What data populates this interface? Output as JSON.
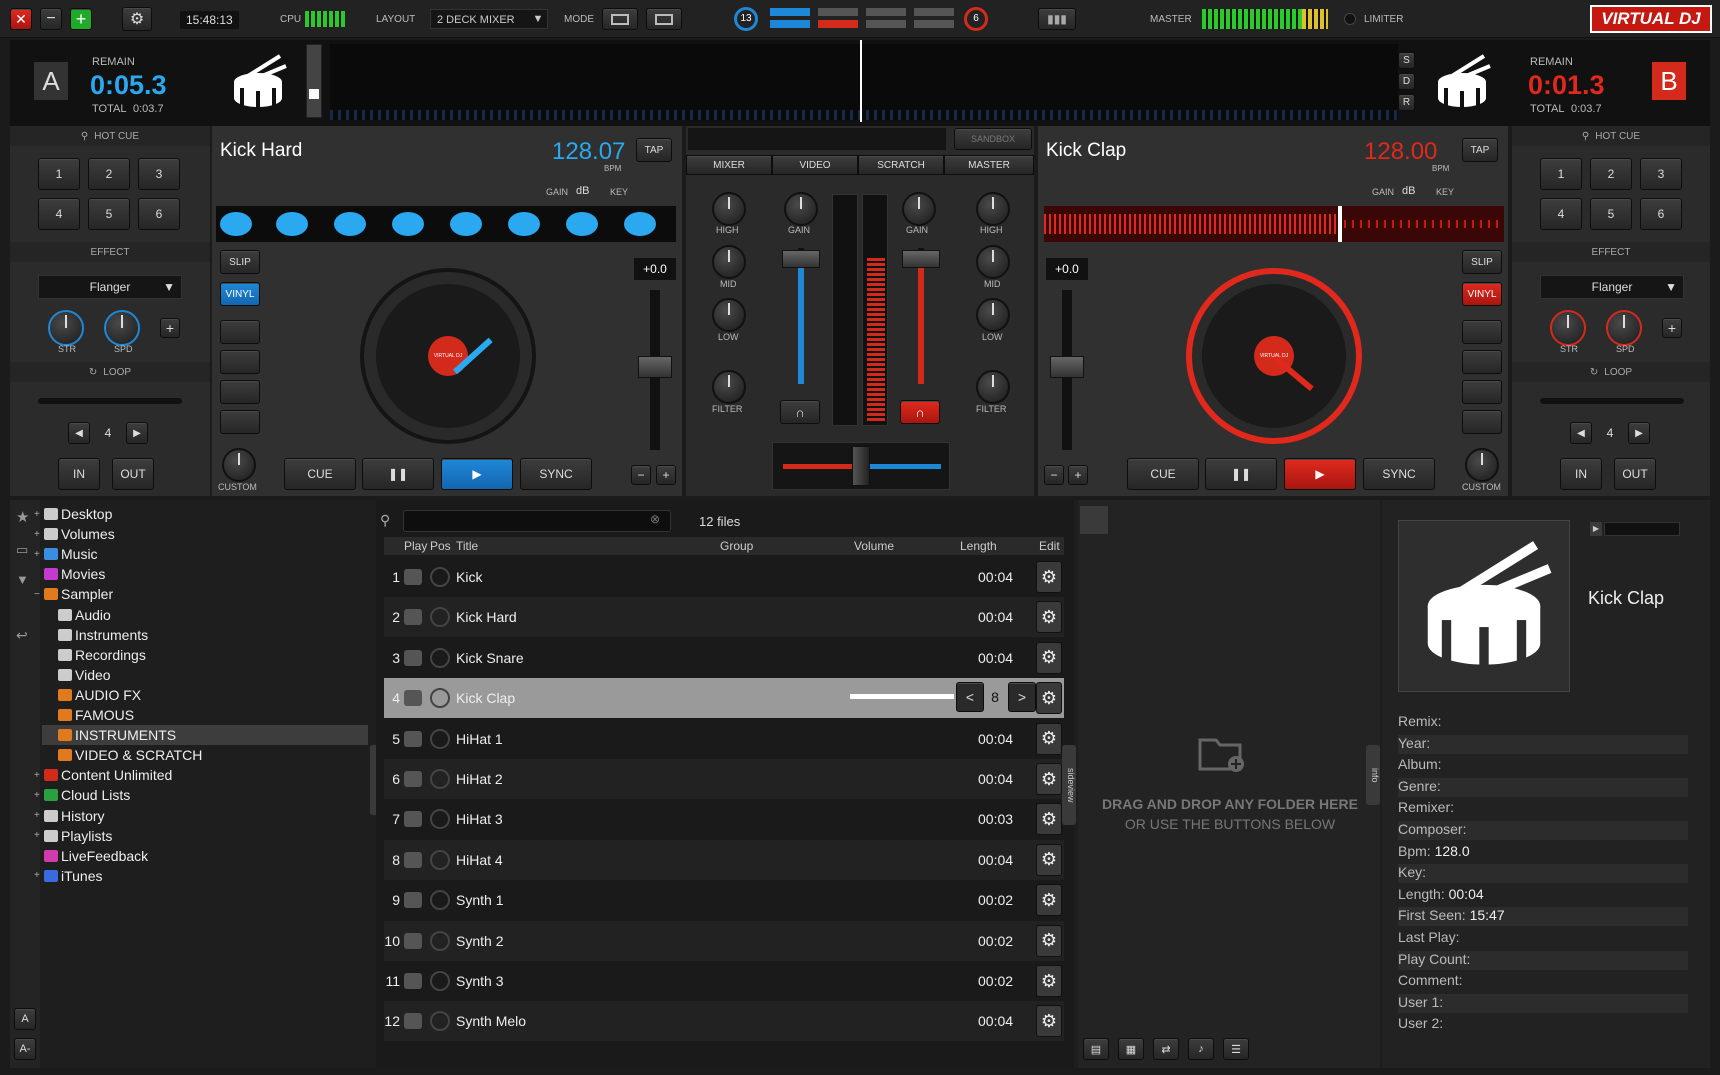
{
  "topbar": {
    "close": "✕",
    "minimize": "−",
    "maximize": "+",
    "settings": "⚙",
    "time": "15:48:13",
    "cpu_label": "CPU",
    "layout_label": "LAYOUT",
    "layout_value": "2 DECK MIXER",
    "mode_label": "MODE",
    "left_count": "13",
    "right_count": "6",
    "master_label": "MASTER",
    "limiter_label": "LIMITER",
    "logo": "VIRTUAL DJ"
  },
  "deckA": {
    "letter": "A",
    "remain_label": "REMAIN",
    "remain": "0:05.3",
    "total_label": "TOTAL",
    "total": "0:03.7",
    "title": "Kick Hard",
    "bpm": "128.07",
    "bpm_label": "BPM",
    "tap": "TAP",
    "gain": "GAIN",
    "db": "dB",
    "key": "KEY",
    "pitch": "+0.0",
    "slip": "SLIP",
    "vinyl": "VINYL",
    "custom": "CUSTOM",
    "cue": "CUE",
    "pause": "❚❚",
    "play": "▶",
    "sync": "SYNC",
    "minus": "−",
    "plus": "+"
  },
  "deckB": {
    "letter": "B",
    "remain_label": "REMAIN",
    "remain": "0:01.3",
    "total_label": "TOTAL",
    "total": "0:03.7",
    "title": "Kick Clap",
    "bpm": "128.00",
    "bpm_label": "BPM",
    "tap": "TAP",
    "gain": "GAIN",
    "db": "dB",
    "key": "KEY",
    "pitch": "+0.0",
    "slip": "SLIP",
    "vinyl": "VINYL",
    "custom": "CUSTOM",
    "cue": "CUE",
    "pause": "❚❚",
    "play": "▶",
    "sync": "SYNC",
    "minus": "−",
    "plus": "+"
  },
  "side_letters": [
    "S",
    "D",
    "R"
  ],
  "left_panel": {
    "hotcue": "HOT CUE",
    "cues": [
      "1",
      "2",
      "3",
      "4",
      "5",
      "6"
    ],
    "effect": "EFFECT",
    "effect_name": "Flanger",
    "str": "STR",
    "spd": "SPD",
    "plus": "+",
    "loop": "LOOP",
    "loop_value": "4",
    "in": "IN",
    "out": "OUT",
    "prev": "◀",
    "next": "▶"
  },
  "right_panel": {
    "hotcue": "HOT CUE",
    "cues": [
      "1",
      "2",
      "3",
      "4",
      "5",
      "6"
    ],
    "effect": "EFFECT",
    "effect_name": "Flanger",
    "str": "STR",
    "spd": "SPD",
    "plus": "+",
    "loop": "LOOP",
    "loop_value": "4",
    "in": "IN",
    "out": "OUT",
    "prev": "◀",
    "next": "▶"
  },
  "mixer": {
    "sandbox": "SANDBOX",
    "tabs": [
      "MIXER",
      "VIDEO",
      "SCRATCH",
      "MASTER"
    ],
    "high": "HIGH",
    "mid": "MID",
    "low": "LOW",
    "filter": "FILTER",
    "gain": "GAIN"
  },
  "platter_label": "VIRTUAL DJ",
  "browser": {
    "tree": [
      {
        "label": "Desktop",
        "color": "#ccc",
        "indent": 0,
        "exp": "+"
      },
      {
        "label": "Volumes",
        "color": "#ccc",
        "indent": 0,
        "exp": "+"
      },
      {
        "label": "Music",
        "color": "#3a8de0",
        "indent": 0,
        "exp": "+"
      },
      {
        "label": "Movies",
        "color": "#c33ad0",
        "indent": 0,
        "exp": ""
      },
      {
        "label": "Sampler",
        "color": "#e07a1e",
        "indent": 0,
        "exp": "−"
      },
      {
        "label": "Audio",
        "color": "#ccc",
        "indent": 1,
        "exp": ""
      },
      {
        "label": "Instruments",
        "color": "#ccc",
        "indent": 1,
        "exp": ""
      },
      {
        "label": "Recordings",
        "color": "#ccc",
        "indent": 1,
        "exp": ""
      },
      {
        "label": "Video",
        "color": "#ccc",
        "indent": 1,
        "exp": ""
      },
      {
        "label": "AUDIO FX",
        "color": "#e07a1e",
        "indent": 1,
        "exp": ""
      },
      {
        "label": "FAMOUS",
        "color": "#e07a1e",
        "indent": 1,
        "exp": ""
      },
      {
        "label": "INSTRUMENTS",
        "color": "#e07a1e",
        "indent": 1,
        "exp": ""
      },
      {
        "label": "VIDEO & SCRATCH",
        "color": "#e07a1e",
        "indent": 1,
        "exp": ""
      },
      {
        "label": "Content Unlimited",
        "color": "#d42a1c",
        "indent": 0,
        "exp": "+"
      },
      {
        "label": "Cloud Lists",
        "color": "#2aa040",
        "indent": 0,
        "exp": "+"
      },
      {
        "label": "History",
        "color": "#ccc",
        "indent": 0,
        "exp": "+"
      },
      {
        "label": "Playlists",
        "color": "#ccc",
        "indent": 0,
        "exp": "+"
      },
      {
        "label": "LiveFeedback",
        "color": "#d43ab0",
        "indent": 0,
        "exp": ""
      },
      {
        "label": "iTunes",
        "color": "#3a6ae0",
        "indent": 0,
        "exp": "+"
      }
    ],
    "files_count": "12 files",
    "folders_tab": "folders",
    "sideview_tab": "sideview",
    "info_tab": "info",
    "columns": {
      "play": "Play",
      "pos": "Pos",
      "title": "Title",
      "group": "Group",
      "volume": "Volume",
      "length": "Length",
      "edit": "Edit"
    },
    "rows": [
      {
        "n": "1",
        "title": "Kick",
        "length": "00:04"
      },
      {
        "n": "2",
        "title": "Kick Hard",
        "length": "00:04"
      },
      {
        "n": "3",
        "title": "Kick Snare",
        "length": "00:04"
      },
      {
        "n": "4",
        "title": "Kick Clap",
        "length": ""
      },
      {
        "n": "5",
        "title": "HiHat 1",
        "length": "00:04"
      },
      {
        "n": "6",
        "title": "HiHat 2",
        "length": "00:04"
      },
      {
        "n": "7",
        "title": "HiHat 3",
        "length": "00:03"
      },
      {
        "n": "8",
        "title": "HiHat 4",
        "length": "00:04"
      },
      {
        "n": "9",
        "title": "Synth 1",
        "length": "00:02"
      },
      {
        "n": "10",
        "title": "Synth 2",
        "length": "00:02"
      },
      {
        "n": "11",
        "title": "Synth 3",
        "length": "00:02"
      },
      {
        "n": "12",
        "title": "Synth Melo",
        "length": "00:04"
      }
    ],
    "selected_stepper": {
      "prev": "<",
      "value": "8",
      "next": ">"
    },
    "drop_line1": "DRAG AND DROP ANY FOLDER HERE",
    "drop_line2": "OR USE THE BUTTONS BELOW"
  },
  "info": {
    "title": "Kick Clap",
    "fields": [
      {
        "k": "Remix:",
        "v": ""
      },
      {
        "k": "Year:",
        "v": ""
      },
      {
        "k": "Album:",
        "v": ""
      },
      {
        "k": "Genre:",
        "v": ""
      },
      {
        "k": "Remixer:",
        "v": ""
      },
      {
        "k": "Composer:",
        "v": ""
      },
      {
        "k": "Bpm:",
        "v": "128.0"
      },
      {
        "k": "Key:",
        "v": ""
      },
      {
        "k": "Length:",
        "v": "00:04"
      },
      {
        "k": "First Seen:",
        "v": "15:47"
      },
      {
        "k": "Last Play:",
        "v": ""
      },
      {
        "k": "Play Count:",
        "v": ""
      },
      {
        "k": "Comment:",
        "v": ""
      },
      {
        "k": "User 1:",
        "v": ""
      },
      {
        "k": "User 2:",
        "v": ""
      }
    ]
  },
  "bottom_left": [
    "A",
    "A-"
  ]
}
